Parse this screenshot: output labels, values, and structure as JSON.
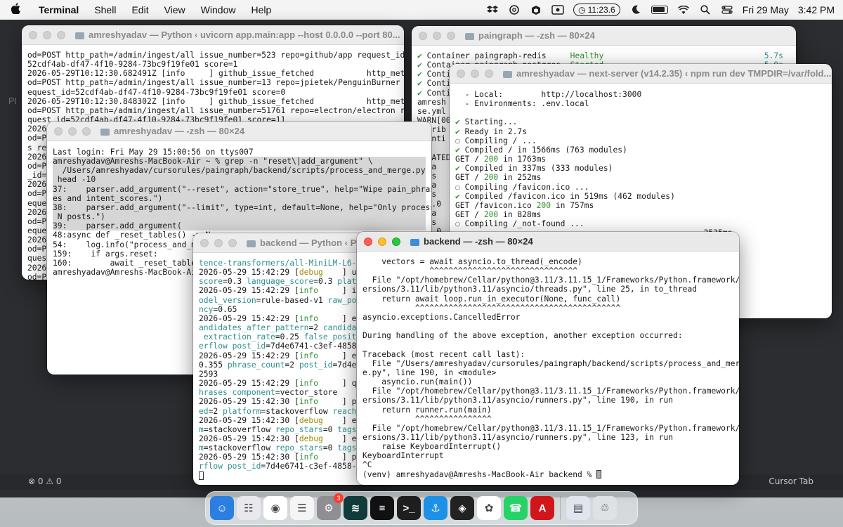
{
  "menubar": {
    "app_name": "Terminal",
    "items": [
      "Shell",
      "Edit",
      "View",
      "Window",
      "Help"
    ],
    "clock_timer": "11:23.6",
    "date": "Fri 29 May",
    "time": "3:42 PM"
  },
  "backdrop": {
    "side_text": "PI",
    "status_left": "⊗ 0 ⚠ 0",
    "status_right": "Cursor Tab"
  },
  "windows": {
    "uvicorn": {
      "title": "amreshyadav — Python ‹ uvicorn app.main:app --host 0.0.0.0 --port 80...",
      "lines": [
        "od=POST http_path=/admin/ingest/all issue_number=523 repo=github/app request_id=",
        "52cdf4ab-df47-4f10-9284-73bc9f19fe01 score=1",
        "2026-05-29T10:12:30.682491Z [info     ] github_issue_fetched           http_meth",
        "od=POST http_path=/admin/ingest/all issue_number=13 repo=jpietek/PenguinBurner r",
        "equest_id=52cdf4ab-df47-4f10-9284-73bc9f19fe01 score=0",
        "2026-05-29T10:12:30.848302Z [info     ] github_issue_fetched           http_meth",
        "od=POST http_path=/admin/ingest/all issue_number=51761 repo=electron/electron re",
        "quest_id=52cdf4ab-df47-4f10-9284-73bc9f19fe01 score=11",
        "2026",
        "od=P",
        "s re",
        "2026",
        "od=P",
        "_id=",
        "2026",
        "od=P",
        "eque",
        "2026",
        "od=P",
        "eque",
        "2026",
        "od=P",
        "ques",
        "2026",
        "od=P",
        "_id="
      ]
    },
    "paingraph": {
      "title": "paingraph — -zsh — 80×24",
      "status_rows": [
        {
          "check": "✔",
          "label": "Container paingraph-redis",
          "state": "Healthy",
          "time": "5.7s"
        },
        {
          "check": "✔",
          "label": "Container paingraph-postgres",
          "state": "Started",
          "time": "5.9s"
        },
        {
          "check": "✔",
          "label": "Conti",
          "state": "",
          "time": ""
        },
        {
          "check": "✔",
          "label": "Conti",
          "state": "",
          "time": ""
        },
        {
          "check": "✔",
          "label": "Conti",
          "state": "",
          "time": ""
        }
      ],
      "lines": [
        "amresh",
        "se.yml",
        "WARN[00",
        "attrib",
        "otenti",
        "IME",
        "CREATED",
        "ngra",
        "days",
        "ngra",
        "days",
        "0.0.0",
        "ngra",
        "days",
        "0.0.0"
      ]
    },
    "nextserver": {
      "title": "amreshyadav — next-server (v14.2.35) ‹ npm run dev TMPDIR=/var/fold...",
      "lines": [
        {
          "t": "  - Local:        http://localhost:3000"
        },
        {
          "t": "  - Environments: .env.local"
        },
        {
          "t": ""
        },
        {
          "mark": "✔",
          "t": " Starting..."
        },
        {
          "mark": "✔",
          "t": " Ready in 2.7s"
        },
        {
          "mark": "○",
          "t": " Compiling / ..."
        },
        {
          "mark": "✔",
          "t": " Compiled / in 1566ms (763 modules)"
        },
        {
          "pre": "GET / ",
          "code": "200",
          "post": " in 1763ms"
        },
        {
          "mark": "✔",
          "t": " Compiled in 337ms (333 modules)"
        },
        {
          "pre": "GET / ",
          "code": "200",
          "post": " in 252ms"
        },
        {
          "mark": "○",
          "t": " Compiling /favicon.ico ..."
        },
        {
          "mark": "✔",
          "t": " Compiled /favicon.ico in 519ms (462 modules)"
        },
        {
          "pre": "GET /favicon.ico ",
          "code": "200",
          "post": " in 757ms"
        },
        {
          "pre": "GET / ",
          "code": "200",
          "post": " in 828ms"
        },
        {
          "mark": "○",
          "t": " Compiling /_not-found ..."
        },
        {
          "t": "                                                    2535ms"
        }
      ]
    },
    "zsh_grep": {
      "title": "amreshyadav — -zsh — 80×24",
      "lines": [
        "Last login: Fri May 29 15:00:56 on ttys007",
        "amreshyadav@Amreshs-MacBook-Air ~ % grep -n \"reset\\|add_argument\" \\",
        "  /Users/amreshyadav/cursorules/paingraph/backend/scripts/process_and_merge.py |",
        " head -10",
        "37:    parser.add_argument(\"--reset\", action=\"store_true\", help=\"Wipe pain_phras",
        "es and intent_scores.\")",
        "38:    parser.add_argument(\"--limit\", type=int, default=None, help=\"Only process",
        " N posts.\")",
        "39:    parser.add_argument(",
        "48:async def _reset_tables() -> N",
        "54:    log.info(\"process_and_m",
        "159:    if args.reset:",
        "160:        await _reset_table",
        "amreshyadav@Amreshs-MacBook-Ai"
      ]
    },
    "backend_python": {
      "title": "backend — Python ‹ Py",
      "lines": [
        {
          "parts": [
            [
              "c-cy",
              "tence-transformers/all-MiniLM-L6-v"
            ]
          ]
        },
        {
          "parts": [
            [
              "",
              "2026-05-29 15:42:29 ["
            ],
            [
              "c-yel",
              "debug"
            ],
            [
              "",
              "    ] ur"
            ]
          ]
        },
        {
          "parts": [
            [
              "c-cy",
              "score"
            ],
            [
              "",
              "=0.3 "
            ],
            [
              "c-cy",
              "language_score"
            ],
            [
              "",
              "=0.3 "
            ],
            [
              "c-cy",
              "platf"
            ]
          ]
        },
        {
          "parts": [
            [
              "",
              "2026-05-29 15:42:29 ["
            ],
            [
              "c-grn",
              "info"
            ],
            [
              "",
              "     ] in"
            ]
          ]
        },
        {
          "parts": [
            [
              "c-cy",
              "odel_version"
            ],
            [
              "",
              "=rule-based-v1 "
            ],
            [
              "c-cy",
              "raw_pos"
            ]
          ]
        },
        {
          "parts": [
            [
              "c-cy",
              "ncy"
            ],
            [
              "",
              "=0.65"
            ]
          ]
        },
        {
          "parts": [
            [
              "",
              "2026-05-29 15:42:29 ["
            ],
            [
              "c-grn",
              "info"
            ],
            [
              "",
              "     ] ex"
            ]
          ]
        },
        {
          "parts": [
            [
              "c-cy",
              "andidates_after_pattern"
            ],
            [
              "",
              "=2 "
            ],
            [
              "c-cy",
              "candidat"
            ]
          ]
        },
        {
          "parts": [
            [
              "c-cy",
              " extraction_rate"
            ],
            [
              "",
              "=0.25 "
            ],
            [
              "c-cy",
              "false_positi"
            ]
          ]
        },
        {
          "parts": [
            [
              "c-cy",
              "erflow "
            ],
            [
              "c-cy",
              "post_id"
            ],
            [
              "",
              "=7d4e6741-c3ef-4858-"
            ]
          ]
        },
        {
          "parts": [
            [
              "",
              "2026-05-29 15:42:29 ["
            ],
            [
              "c-grn",
              "info"
            ],
            [
              "",
              "     ] ex"
            ]
          ]
        },
        {
          "parts": [
            [
              "",
              "0.355 "
            ],
            [
              "c-cy",
              "phrase_count"
            ],
            [
              "",
              "=2 "
            ],
            [
              "c-cy",
              "post_id"
            ],
            [
              "",
              "=7d4e6"
            ]
          ]
        },
        {
          "parts": [
            [
              "",
              "2593"
            ]
          ]
        },
        {
          "parts": [
            [
              "",
              "2026-05-29 15:42:29 ["
            ],
            [
              "c-grn",
              "info"
            ],
            [
              "",
              "     ] qd"
            ]
          ]
        },
        {
          "parts": [
            [
              "c-cy",
              "hrases "
            ],
            [
              "c-cy",
              "component"
            ],
            [
              "",
              "=vector_store"
            ]
          ]
        },
        {
          "parts": [
            [
              "",
              "2026-05-29 15:42:30 ["
            ],
            [
              "c-grn",
              "info"
            ],
            [
              "",
              "     ] pe"
            ]
          ]
        },
        {
          "parts": [
            [
              "c-cy",
              "ed"
            ],
            [
              "",
              "=2 "
            ],
            [
              "c-cy",
              "platform"
            ],
            [
              "",
              "=stackoverflow "
            ],
            [
              "c-cy",
              "reach_"
            ]
          ]
        },
        {
          "parts": [
            [
              "",
              "2026-05-29 15:42:30 ["
            ],
            [
              "c-yel",
              "debug"
            ],
            [
              "",
              "    ] ec"
            ]
          ]
        },
        {
          "parts": [
            [
              "c-cy",
              "m"
            ],
            [
              "",
              "=stackoverflow "
            ],
            [
              "c-cy",
              "repo_stars"
            ],
            [
              "",
              "=0 "
            ],
            [
              "c-cy",
              "tags"
            ],
            [
              "",
              "="
            ]
          ]
        },
        {
          "parts": [
            [
              "",
              "2026-05-29 15:42:30 ["
            ],
            [
              "c-yel",
              "debug"
            ],
            [
              "",
              "    ] ec"
            ]
          ]
        },
        {
          "parts": [
            [
              "c-cy",
              "m"
            ],
            [
              "",
              "=stackoverflow "
            ],
            [
              "c-cy",
              "repo_stars"
            ],
            [
              "",
              "=0 "
            ],
            [
              "c-cy",
              "tags"
            ],
            [
              "",
              "="
            ]
          ]
        },
        {
          "parts": [
            [
              "",
              "2026-05-29 15:42:30 ["
            ],
            [
              "c-grn",
              "info"
            ],
            [
              "",
              "     ] po"
            ]
          ]
        },
        {
          "parts": [
            [
              "c-cy",
              "rflow "
            ],
            [
              "c-cy",
              "post_id"
            ],
            [
              "",
              "=7d4e6741-c3ef-4858-9"
            ]
          ]
        }
      ]
    },
    "backend_zsh": {
      "title": "backend — -zsh — 80×24",
      "lines": [
        "    vectors = await asyncio.to_thread(_encode)",
        "              ^^^^^^^^^^^^^^^^^^^^^^^^^^^^^^^",
        "  File \"/opt/homebrew/Cellar/python@3.11/3.11.15_1/Frameworks/Python.framework/V",
        "ersions/3.11/lib/python3.11/asyncio/threads.py\", line 25, in to_thread",
        "    return await loop.run_in_executor(None, func_call)",
        "           ^^^^^^^^^^^^^^^^^^^^^^^^^^^^^^^^^^^^^^^^^^^",
        "asyncio.exceptions.CancelledError",
        "",
        "During handling of the above exception, another exception occurred:",
        "",
        "Traceback (most recent call last):",
        "  File \"/Users/amreshyadav/cursorules/paingraph/backend/scripts/process_and_merg",
        "e.py\", line 190, in <module>",
        "    asyncio.run(main())",
        "  File \"/opt/homebrew/Cellar/python@3.11/3.11.15_1/Frameworks/Python.framework/V",
        "ersions/3.11/lib/python3.11/asyncio/runners.py\", line 190, in run",
        "    return runner.run(main)",
        "           ^^^^^^^^^^^^^^^^",
        "  File \"/opt/homebrew/Cellar/python@3.11/3.11.15_1/Frameworks/Python.framework/V",
        "ersions/3.11/lib/python3.11/asyncio/runners.py\", line 123, in run",
        "    raise KeyboardInterrupt()",
        "KeyboardInterrupt",
        "^C"
      ],
      "prompt": "(venv) amreshyadav@Amreshs-MacBook-Air backend % "
    }
  },
  "dock": {
    "apps": [
      {
        "name": "finder-icon",
        "glyph": "☺",
        "color": "#2a7fe0"
      },
      {
        "name": "launchpad-icon",
        "glyph": "☷",
        "color": "#e8e8ee"
      },
      {
        "name": "chrome-icon",
        "glyph": "◉",
        "color": "#ffffff"
      },
      {
        "name": "reminders-icon",
        "glyph": "☰",
        "color": "#f5f5f5"
      },
      {
        "name": "system-settings-icon",
        "glyph": "⚙",
        "color": "#8e8e93",
        "badge": "3"
      },
      {
        "name": "windsurf-icon",
        "glyph": "≋",
        "color": "#0f3b3b"
      },
      {
        "name": "spotify-icon",
        "glyph": "≡",
        "color": "#111111"
      },
      {
        "name": "terminal-icon",
        "glyph": ">_",
        "color": "#1e1e1e"
      },
      {
        "name": "docker-icon",
        "glyph": "⚓",
        "color": "#1d91e6"
      },
      {
        "name": "cursor-icon",
        "glyph": "◈",
        "color": "#222222"
      },
      {
        "name": "chatgpt-icon",
        "glyph": "✿",
        "color": "#ffffff"
      },
      {
        "name": "whatsapp-icon",
        "glyph": "☎",
        "color": "#25d366"
      },
      {
        "name": "acrobat-icon",
        "glyph": "A",
        "color": "#d0161b"
      }
    ],
    "trailing": [
      {
        "name": "desktop-preview-icon",
        "glyph": "▤",
        "color": "#dfe6ee"
      },
      {
        "name": "trash-icon",
        "glyph": "♲",
        "color": "#dfe2e5"
      }
    ]
  }
}
